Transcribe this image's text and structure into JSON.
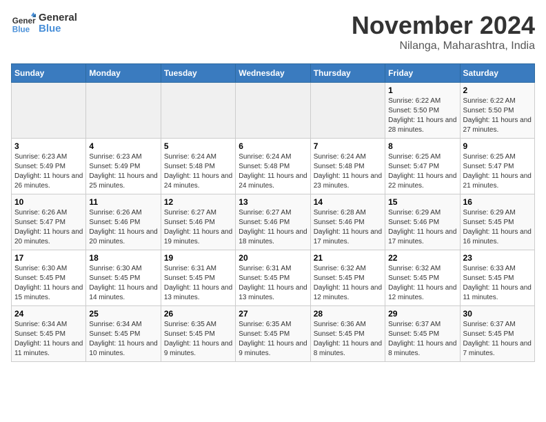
{
  "header": {
    "logo_line1": "General",
    "logo_line2": "Blue",
    "month": "November 2024",
    "location": "Nilanga, Maharashtra, India"
  },
  "weekdays": [
    "Sunday",
    "Monday",
    "Tuesday",
    "Wednesday",
    "Thursday",
    "Friday",
    "Saturday"
  ],
  "weeks": [
    [
      {
        "day": "",
        "info": ""
      },
      {
        "day": "",
        "info": ""
      },
      {
        "day": "",
        "info": ""
      },
      {
        "day": "",
        "info": ""
      },
      {
        "day": "",
        "info": ""
      },
      {
        "day": "1",
        "info": "Sunrise: 6:22 AM\nSunset: 5:50 PM\nDaylight: 11 hours and 28 minutes."
      },
      {
        "day": "2",
        "info": "Sunrise: 6:22 AM\nSunset: 5:50 PM\nDaylight: 11 hours and 27 minutes."
      }
    ],
    [
      {
        "day": "3",
        "info": "Sunrise: 6:23 AM\nSunset: 5:49 PM\nDaylight: 11 hours and 26 minutes."
      },
      {
        "day": "4",
        "info": "Sunrise: 6:23 AM\nSunset: 5:49 PM\nDaylight: 11 hours and 25 minutes."
      },
      {
        "day": "5",
        "info": "Sunrise: 6:24 AM\nSunset: 5:48 PM\nDaylight: 11 hours and 24 minutes."
      },
      {
        "day": "6",
        "info": "Sunrise: 6:24 AM\nSunset: 5:48 PM\nDaylight: 11 hours and 24 minutes."
      },
      {
        "day": "7",
        "info": "Sunrise: 6:24 AM\nSunset: 5:48 PM\nDaylight: 11 hours and 23 minutes."
      },
      {
        "day": "8",
        "info": "Sunrise: 6:25 AM\nSunset: 5:47 PM\nDaylight: 11 hours and 22 minutes."
      },
      {
        "day": "9",
        "info": "Sunrise: 6:25 AM\nSunset: 5:47 PM\nDaylight: 11 hours and 21 minutes."
      }
    ],
    [
      {
        "day": "10",
        "info": "Sunrise: 6:26 AM\nSunset: 5:47 PM\nDaylight: 11 hours and 20 minutes."
      },
      {
        "day": "11",
        "info": "Sunrise: 6:26 AM\nSunset: 5:46 PM\nDaylight: 11 hours and 20 minutes."
      },
      {
        "day": "12",
        "info": "Sunrise: 6:27 AM\nSunset: 5:46 PM\nDaylight: 11 hours and 19 minutes."
      },
      {
        "day": "13",
        "info": "Sunrise: 6:27 AM\nSunset: 5:46 PM\nDaylight: 11 hours and 18 minutes."
      },
      {
        "day": "14",
        "info": "Sunrise: 6:28 AM\nSunset: 5:46 PM\nDaylight: 11 hours and 17 minutes."
      },
      {
        "day": "15",
        "info": "Sunrise: 6:29 AM\nSunset: 5:46 PM\nDaylight: 11 hours and 17 minutes."
      },
      {
        "day": "16",
        "info": "Sunrise: 6:29 AM\nSunset: 5:45 PM\nDaylight: 11 hours and 16 minutes."
      }
    ],
    [
      {
        "day": "17",
        "info": "Sunrise: 6:30 AM\nSunset: 5:45 PM\nDaylight: 11 hours and 15 minutes."
      },
      {
        "day": "18",
        "info": "Sunrise: 6:30 AM\nSunset: 5:45 PM\nDaylight: 11 hours and 14 minutes."
      },
      {
        "day": "19",
        "info": "Sunrise: 6:31 AM\nSunset: 5:45 PM\nDaylight: 11 hours and 13 minutes."
      },
      {
        "day": "20",
        "info": "Sunrise: 6:31 AM\nSunset: 5:45 PM\nDaylight: 11 hours and 13 minutes."
      },
      {
        "day": "21",
        "info": "Sunrise: 6:32 AM\nSunset: 5:45 PM\nDaylight: 11 hours and 12 minutes."
      },
      {
        "day": "22",
        "info": "Sunrise: 6:32 AM\nSunset: 5:45 PM\nDaylight: 11 hours and 12 minutes."
      },
      {
        "day": "23",
        "info": "Sunrise: 6:33 AM\nSunset: 5:45 PM\nDaylight: 11 hours and 11 minutes."
      }
    ],
    [
      {
        "day": "24",
        "info": "Sunrise: 6:34 AM\nSunset: 5:45 PM\nDaylight: 11 hours and 11 minutes."
      },
      {
        "day": "25",
        "info": "Sunrise: 6:34 AM\nSunset: 5:45 PM\nDaylight: 11 hours and 10 minutes."
      },
      {
        "day": "26",
        "info": "Sunrise: 6:35 AM\nSunset: 5:45 PM\nDaylight: 11 hours and 9 minutes."
      },
      {
        "day": "27",
        "info": "Sunrise: 6:35 AM\nSunset: 5:45 PM\nDaylight: 11 hours and 9 minutes."
      },
      {
        "day": "28",
        "info": "Sunrise: 6:36 AM\nSunset: 5:45 PM\nDaylight: 11 hours and 8 minutes."
      },
      {
        "day": "29",
        "info": "Sunrise: 6:37 AM\nSunset: 5:45 PM\nDaylight: 11 hours and 8 minutes."
      },
      {
        "day": "30",
        "info": "Sunrise: 6:37 AM\nSunset: 5:45 PM\nDaylight: 11 hours and 7 minutes."
      }
    ]
  ]
}
